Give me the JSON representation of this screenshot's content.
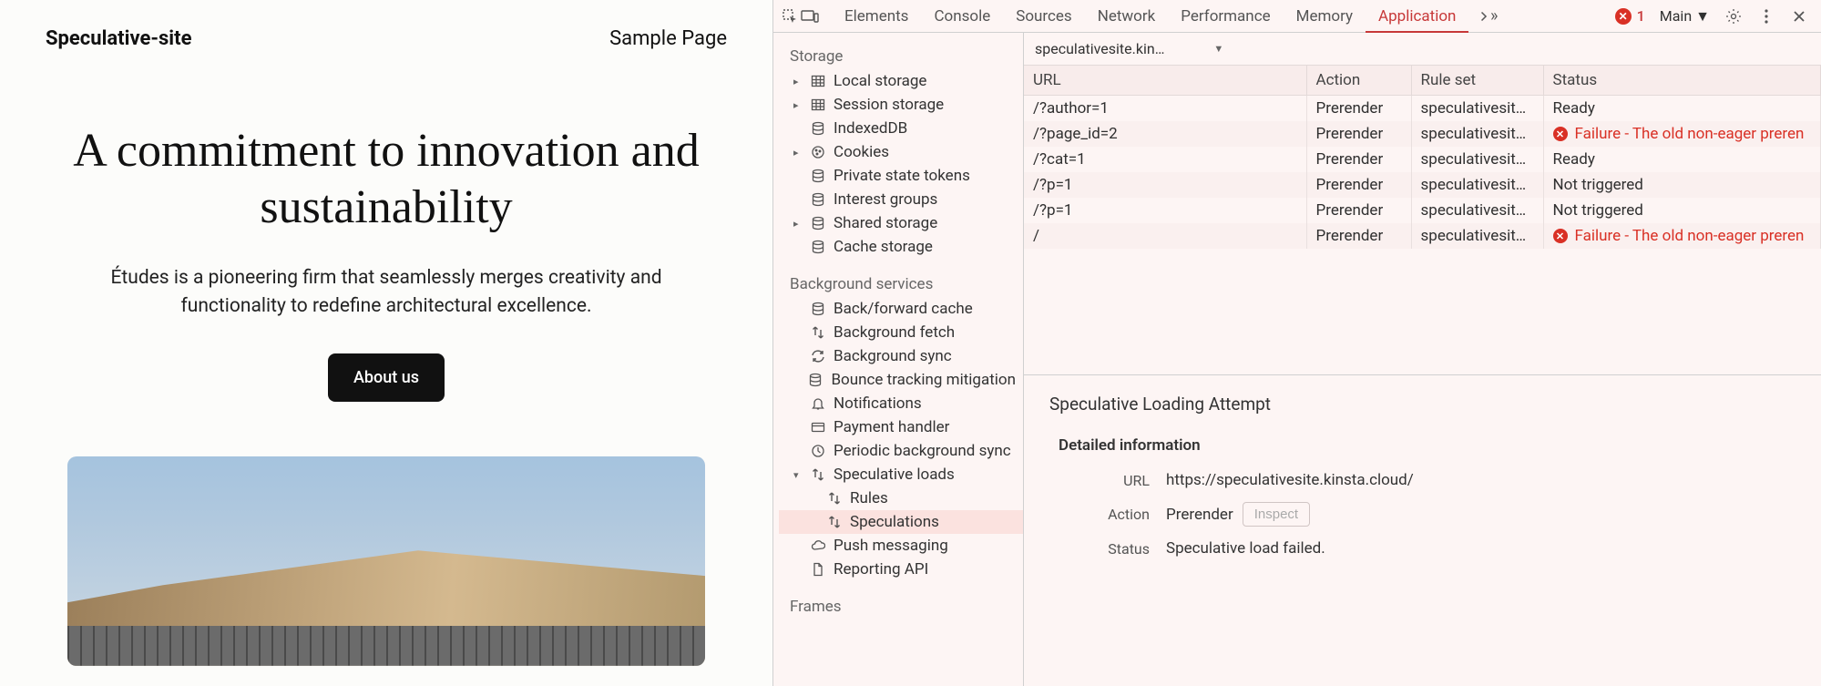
{
  "website": {
    "title": "Speculative-site",
    "nav": "Sample Page",
    "hero_heading": "A commitment to innovation and sustainability",
    "hero_text": "Études is a pioneering firm that seamlessly merges creativity and functionality to redefine architectural excellence.",
    "cta": "About us"
  },
  "devtools": {
    "tabs": [
      "Elements",
      "Console",
      "Sources",
      "Network",
      "Performance",
      "Memory",
      "Application"
    ],
    "active_tab": "Application",
    "error_count": "1",
    "context_label": "Main",
    "filter_value": "speculativesite.kin…",
    "sidebar": {
      "storage_label": "Storage",
      "storage_items": [
        {
          "label": "Local storage",
          "icon": "table",
          "expandable": true
        },
        {
          "label": "Session storage",
          "icon": "table",
          "expandable": true
        },
        {
          "label": "IndexedDB",
          "icon": "db",
          "expandable": false
        },
        {
          "label": "Cookies",
          "icon": "cookie",
          "expandable": true
        },
        {
          "label": "Private state tokens",
          "icon": "db",
          "expandable": false
        },
        {
          "label": "Interest groups",
          "icon": "db",
          "expandable": false
        },
        {
          "label": "Shared storage",
          "icon": "db",
          "expandable": true
        },
        {
          "label": "Cache storage",
          "icon": "db",
          "expandable": false
        }
      ],
      "bgservices_label": "Background services",
      "bg_items": [
        {
          "label": "Back/forward cache",
          "icon": "db"
        },
        {
          "label": "Background fetch",
          "icon": "swap"
        },
        {
          "label": "Background sync",
          "icon": "sync"
        },
        {
          "label": "Bounce tracking mitigation",
          "icon": "db"
        },
        {
          "label": "Notifications",
          "icon": "bell"
        },
        {
          "label": "Payment handler",
          "icon": "card"
        },
        {
          "label": "Periodic background sync",
          "icon": "clock"
        },
        {
          "label": "Speculative loads",
          "icon": "swap",
          "expanded": true,
          "children": [
            {
              "label": "Rules"
            },
            {
              "label": "Speculations",
              "selected": true
            }
          ]
        },
        {
          "label": "Push messaging",
          "icon": "cloud"
        },
        {
          "label": "Reporting API",
          "icon": "doc"
        }
      ],
      "frames_label": "Frames"
    },
    "table": {
      "headers": [
        "URL",
        "Action",
        "Rule set",
        "Status"
      ],
      "rows": [
        {
          "url": "/?author=1",
          "action": "Prerender",
          "ruleset": "speculativesite…",
          "status": "Ready",
          "err": false
        },
        {
          "url": "/?page_id=2",
          "action": "Prerender",
          "ruleset": "speculativesite…",
          "status": "Failure - The old non-eager preren",
          "err": true
        },
        {
          "url": "/?cat=1",
          "action": "Prerender",
          "ruleset": "speculativesite…",
          "status": "Ready",
          "err": false
        },
        {
          "url": "/?p=1",
          "action": "Prerender",
          "ruleset": "speculativesite…",
          "status": "Not triggered",
          "err": false
        },
        {
          "url": "/?p=1",
          "action": "Prerender",
          "ruleset": "speculativesite…",
          "status": "Not triggered",
          "err": false
        },
        {
          "url": "/",
          "action": "Prerender",
          "ruleset": "speculativesite…",
          "status": "Failure - The old non-eager preren",
          "err": true
        }
      ]
    },
    "detail": {
      "title": "Speculative Loading Attempt",
      "subtitle": "Detailed information",
      "url_label": "URL",
      "url_value": "https://speculativesite.kinsta.cloud/",
      "action_label": "Action",
      "action_value": "Prerender",
      "inspect_label": "Inspect",
      "status_label": "Status",
      "status_value": "Speculative load failed."
    }
  }
}
